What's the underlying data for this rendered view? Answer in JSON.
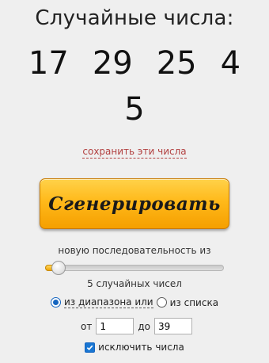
{
  "header": {
    "title": "Случайные числа:"
  },
  "results": {
    "row1": [
      "17",
      "29",
      "25",
      "4"
    ],
    "row2": [
      "5"
    ]
  },
  "save_link": "сохранить эти числа",
  "generate_button": "Сгенерировать",
  "sequence_label": "новую последовательность из",
  "slider": {
    "value": 5,
    "min": 1,
    "max": 100,
    "fraction": 0.04
  },
  "count_label": "5 случайных чисел",
  "source": {
    "range_label": "из диапазона или",
    "list_label": "из списка",
    "selected": "range"
  },
  "range": {
    "from_label": "от",
    "from_value": "1",
    "to_label": "до",
    "to_value": "39"
  },
  "exclude": {
    "label": "исключить числа",
    "checked": true
  },
  "colors": {
    "accent": "#1565c0",
    "button": "#ffb91a",
    "link": "#b24040"
  }
}
